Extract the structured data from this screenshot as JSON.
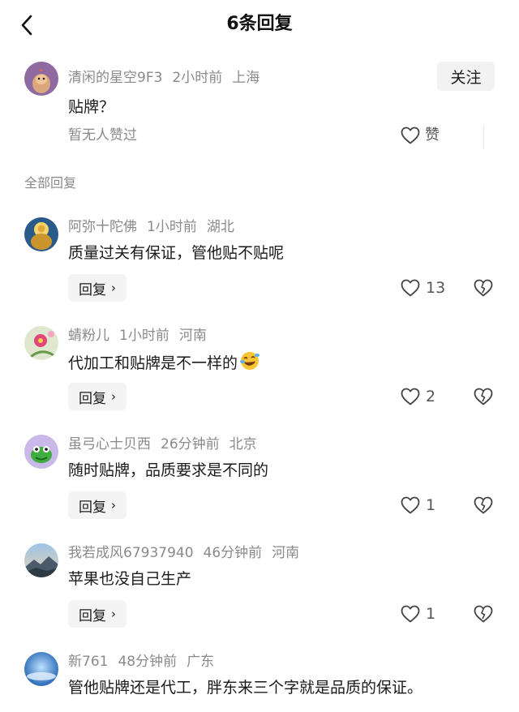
{
  "header": {
    "title": "6条回复"
  },
  "main_comment": {
    "username": "清闲的星空9F3",
    "time": "2小时前",
    "location": "上海",
    "text": "贴牌？",
    "follow_label": "关注",
    "no_likes_text": "暂无人赞过",
    "like_label": "赞"
  },
  "section_label": "全部回复",
  "reply_button_label": "回复",
  "replies": [
    {
      "username": "阿弥十陀佛",
      "time": "1小时前",
      "location": "湖北",
      "text": "质量过关有保证，管他贴不贴呢",
      "likes": "13"
    },
    {
      "username": "蜻粉儿",
      "time": "1小时前",
      "location": "河南",
      "text": "代加工和贴牌是不一样的",
      "likes": "2",
      "emoji": "laughing-crying-emoji"
    },
    {
      "username": "虽弓心士贝西",
      "time": "26分钟前",
      "location": "北京",
      "text": "随时贴牌，品质要求是不同的",
      "likes": "1"
    },
    {
      "username": "我若成风67937940",
      "time": "46分钟前",
      "location": "河南",
      "text": "苹果也没自己生产",
      "likes": "1"
    },
    {
      "username": "新761",
      "time": "48分钟前",
      "location": "广东",
      "text": "管他贴牌还是代工，胖东来三个字就是品质的保证。"
    }
  ]
}
